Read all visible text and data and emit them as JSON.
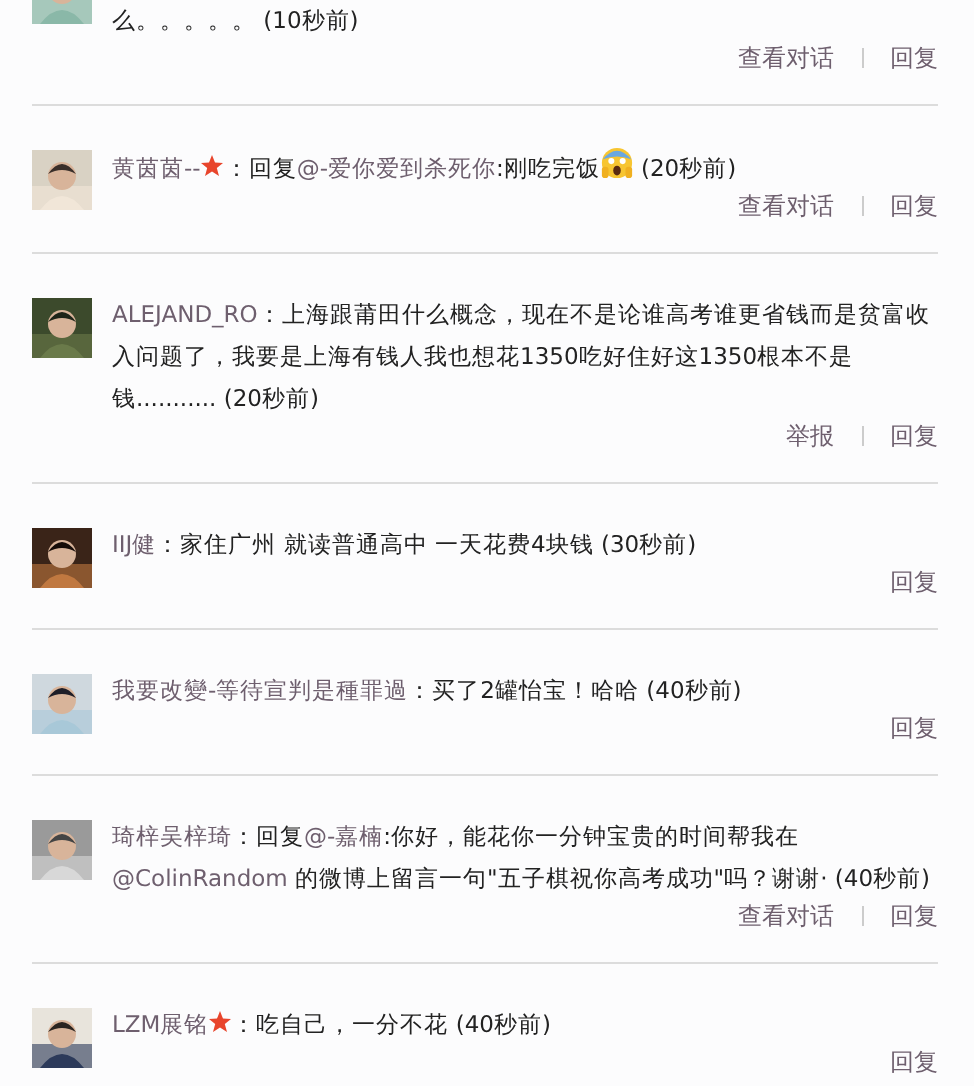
{
  "comments": [
    {
      "verified": false,
      "parts": [
        {
          "kind": "text",
          "text": "么。。。。。"
        }
      ],
      "time": "(10秒前)",
      "actions": [
        "查看对话",
        "回复"
      ]
    },
    {
      "author": "黄茵茵--",
      "verified": true,
      "parts": [
        {
          "kind": "text",
          "text": "：回复"
        },
        {
          "kind": "mention",
          "text": "@-爱你爱到杀死你"
        },
        {
          "kind": "text",
          "text": ":刚吃完饭"
        },
        {
          "kind": "emoji"
        }
      ],
      "time": "(20秒前)",
      "actions": [
        "查看对话",
        "回复"
      ]
    },
    {
      "author": "ALEJAND_RO",
      "verified": false,
      "parts": [
        {
          "kind": "text",
          "text": "：上海跟莆田什么概念，现在不是论谁高考谁更省钱而是贫富收入问题了，我要是上海有钱人我也想花1350吃好住好这1350根本不是钱..........."
        }
      ],
      "time": "(20秒前)",
      "actions": [
        "举报",
        "回复"
      ]
    },
    {
      "author": "IIJ健",
      "verified": false,
      "parts": [
        {
          "kind": "text",
          "text": "：家住广州 就读普通高中 一天花费4块钱"
        }
      ],
      "time": "(30秒前)",
      "actions": [
        "回复"
      ]
    },
    {
      "author": "我要改變-等待宣判是種罪過",
      "verified": false,
      "parts": [
        {
          "kind": "text",
          "text": "：买了2罐怡宝！哈哈"
        }
      ],
      "time": "(40秒前)",
      "actions": [
        "回复"
      ]
    },
    {
      "author": "琦梓吴梓琦",
      "verified": false,
      "parts": [
        {
          "kind": "text",
          "text": "：回复"
        },
        {
          "kind": "mention",
          "text": "@-嘉楠"
        },
        {
          "kind": "text",
          "text": ":你好，能花你一分钟宝贵的时间帮我在 "
        },
        {
          "kind": "mention",
          "text": "@ColinRandom"
        },
        {
          "kind": "text",
          "text": " 的微博上留言一句\"五子棋祝你高考成功\"吗？谢谢·"
        }
      ],
      "time": "(40秒前)",
      "actions": [
        "查看对话",
        "回复"
      ]
    },
    {
      "author": "LZM展铭",
      "verified": true,
      "parts": [
        {
          "kind": "text",
          "text": "：吃自己，一分不花"
        }
      ],
      "time": "(40秒前)",
      "actions": [
        "回复"
      ]
    }
  ]
}
